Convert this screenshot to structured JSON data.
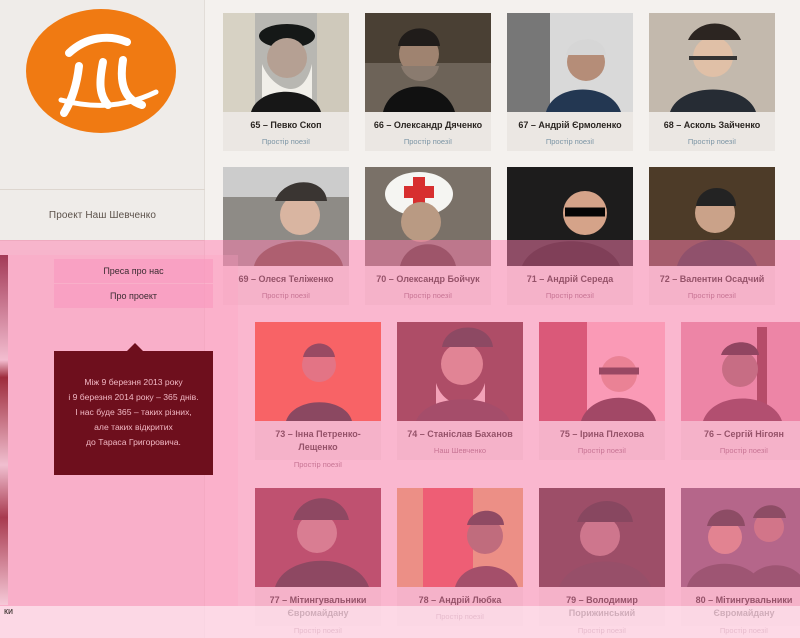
{
  "sidebar": {
    "title": "Проект Наш Шевченко",
    "nav": [
      "Преса про нас",
      "Про проект"
    ],
    "info": [
      "Між 9 березня 2013 року",
      "і 9 березня 2014 року – 365 днів.",
      "І нас буде 365 – таких різних,",
      "але таких відкритих",
      "до Тараса Григоровича."
    ],
    "bottom_fragment": "ки"
  },
  "cards": [
    {
      "name": "65 – Певко Скоп",
      "tag": "Простір поезії"
    },
    {
      "name": "66 – Олександр Дяченко",
      "tag": "Простір поезії"
    },
    {
      "name": "67 – Андрій Єрмоленко",
      "tag": "Простір поезії"
    },
    {
      "name": "68 – Асколь Зайченко",
      "tag": "Простір поезії"
    },
    {
      "name": "69 – Олеся Теліженко",
      "tag": "Простір поезії"
    },
    {
      "name": "70 – Олександр Бойчук",
      "tag": "Простір поезії"
    },
    {
      "name": "71 – Андрій Середа",
      "tag": "Простір поезії"
    },
    {
      "name": "72 – Валентин Осадчий",
      "tag": "Простір поезії"
    },
    {
      "name": "73 – Інна Петренко-Лещенко",
      "tag": "Простір поезії"
    },
    {
      "name": "74 – Станіслав Баханов",
      "tag": "Наш Шевченко"
    },
    {
      "name": "75 – Ірина Плехова",
      "tag": "Простір поезії"
    },
    {
      "name": "76 – Сергій Нігоян",
      "tag": "Простір поезії"
    },
    {
      "name": "77 – Мітингувальники Євромайдану",
      "tag": "Простір поезії"
    },
    {
      "name": "78 – Андрій Любка",
      "tag": "Простір поезії"
    },
    {
      "name": "79 – Володимир Порижинський",
      "tag": "Простір поезії"
    },
    {
      "name": "80 – Мітингувальники Євромайдану",
      "tag": "Простір поезії"
    }
  ],
  "colors": {
    "logo": "#f07a12",
    "info_bg": "#6e0f1d",
    "tag_link": "#7c95a5",
    "pink_overlay": "#ff7daf"
  }
}
